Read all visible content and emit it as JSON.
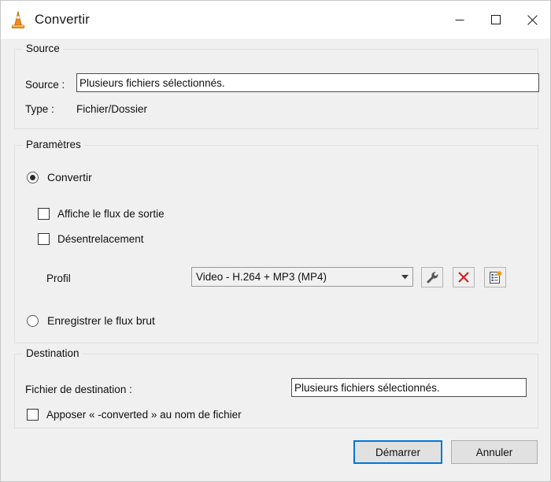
{
  "window": {
    "title": "Convertir",
    "app_icon": "vlc-cone-icon",
    "controls": {
      "minimize": "minimize-icon",
      "maximize": "maximize-icon",
      "close": "close-icon"
    }
  },
  "source_group": {
    "legend": "Source",
    "source_label": "Source :",
    "source_value": "Plusieurs fichiers sélectionnés.",
    "type_label": "Type :",
    "type_value": "Fichier/Dossier"
  },
  "settings_group": {
    "legend": "Paramètres",
    "convert_radio": {
      "label": "Convertir",
      "checked": true
    },
    "display_output_checkbox": {
      "label": "Affiche le flux de sortie",
      "checked": false
    },
    "deinterlace_checkbox": {
      "label": "Désentrelacement",
      "checked": false
    },
    "profile_label": "Profil",
    "profile_value": "Video - H.264 + MP3 (MP4)",
    "profile_buttons": {
      "edit": "wrench-icon",
      "delete": "red-x-icon",
      "create": "new-profile-icon"
    },
    "raw_radio": {
      "label": "Enregistrer le flux brut",
      "checked": false
    }
  },
  "destination_group": {
    "legend": "Destination",
    "file_label": "Fichier de destination :",
    "file_value": "Plusieurs fichiers sélectionnés.",
    "append_checkbox": {
      "label": "Apposer « -converted » au nom de fichier",
      "checked": false
    }
  },
  "footer": {
    "start_button": "Démarrer",
    "cancel_button": "Annuler"
  },
  "colors": {
    "dialog_bg": "#f0f0f0",
    "titlebar_bg": "#ffffff",
    "accent_focus": "#0078d7",
    "delete_red": "#cc2222",
    "vlc_orange": "#e8700a"
  }
}
